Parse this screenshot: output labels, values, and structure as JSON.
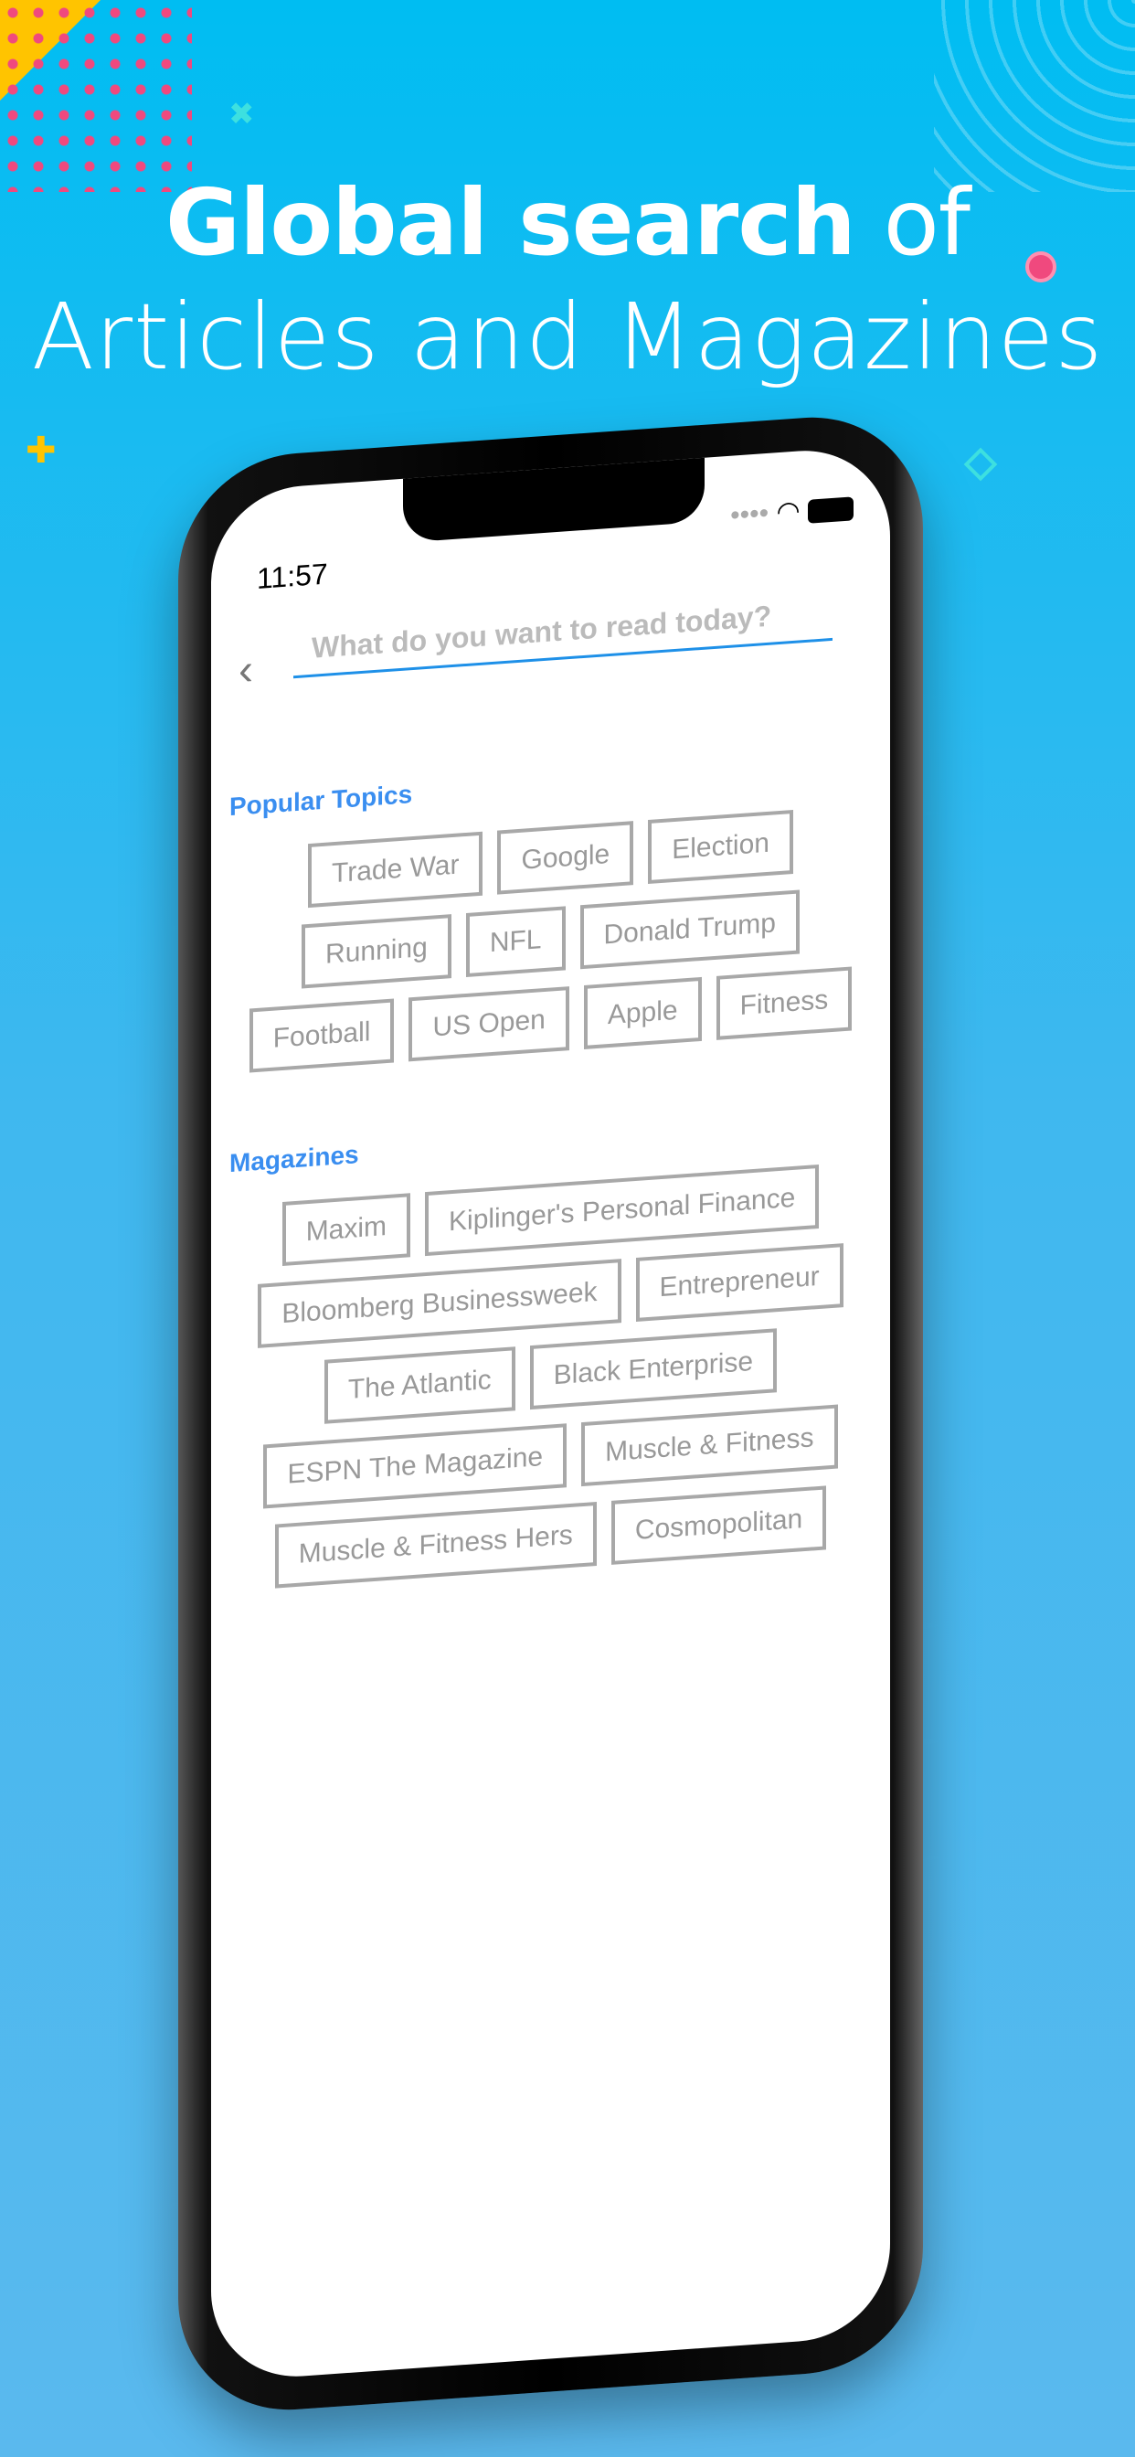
{
  "headline": {
    "bold": "Global search",
    "rest": " of",
    "line2": "Articles and Magazines"
  },
  "colors": {
    "background": "#00bdf2",
    "accent": "#3a8ef0",
    "chip_border": "#a8a8a8"
  },
  "status": {
    "time": "11:57",
    "signal": "••••",
    "wifi_icon": "wifi-icon",
    "battery_icon": "battery-icon"
  },
  "search": {
    "placeholder": "What do you want to read today?",
    "back_icon": "chevron-left-icon"
  },
  "popular": {
    "title": "Popular Topics",
    "items": [
      "Trade War",
      "Google",
      "Election",
      "Running",
      "NFL",
      "Donald Trump",
      "Football",
      "US Open",
      "Apple",
      "Fitness"
    ]
  },
  "magazines": {
    "title": "Magazines",
    "items": [
      "Maxim",
      "Kiplinger's Personal Finance",
      "Bloomberg Businessweek",
      "Entrepreneur",
      "The Atlantic",
      "Black Enterprise",
      "ESPN The Magazine",
      "Muscle & Fitness",
      "Muscle & Fitness Hers",
      "Cosmopolitan"
    ]
  }
}
